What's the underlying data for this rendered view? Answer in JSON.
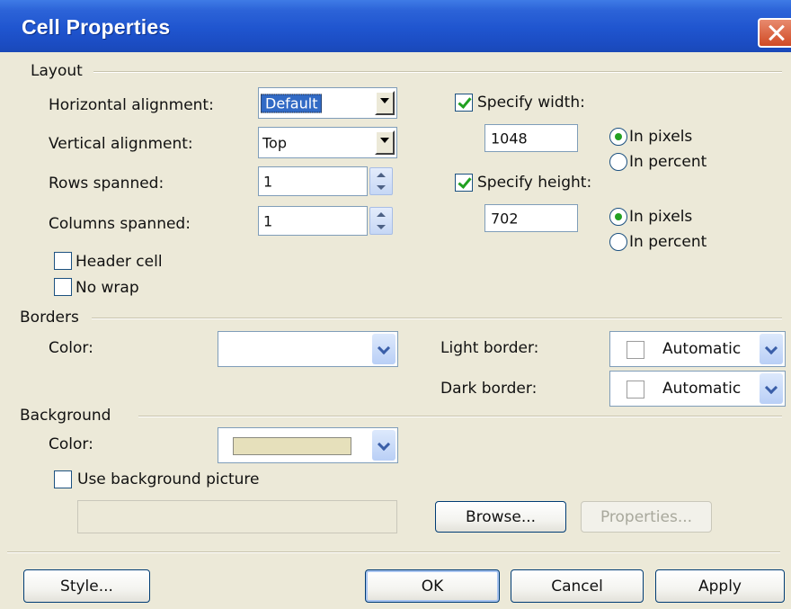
{
  "window": {
    "title": "Cell Properties"
  },
  "layout": {
    "section_label": "Layout",
    "horizontal_alignment_label": "Horizontal alignment:",
    "horizontal_alignment_value": "Default",
    "vertical_alignment_label": "Vertical alignment:",
    "vertical_alignment_value": "Top",
    "rows_spanned_label": "Rows spanned:",
    "rows_spanned_value": "1",
    "columns_spanned_label": "Columns spanned:",
    "columns_spanned_value": "1",
    "header_cell_label": "Header cell",
    "header_cell_checked": false,
    "no_wrap_label": "No wrap",
    "no_wrap_checked": false,
    "specify_width_label": "Specify width:",
    "specify_width_checked": true,
    "width_value": "1048",
    "width_unit_pixels_label": "In pixels",
    "width_unit_percent_label": "In percent",
    "width_unit_selected": "pixels",
    "specify_height_label": "Specify height:",
    "specify_height_checked": true,
    "height_value": "702",
    "height_unit_pixels_label": "In pixels",
    "height_unit_percent_label": "In percent",
    "height_unit_selected": "pixels"
  },
  "borders": {
    "section_label": "Borders",
    "color_label": "Color:",
    "color_value": "",
    "light_border_label": "Light border:",
    "light_border_value": "Automatic",
    "dark_border_label": "Dark border:",
    "dark_border_value": "Automatic"
  },
  "background": {
    "section_label": "Background",
    "color_label": "Color:",
    "color_swatch": "#e6e0bb",
    "use_picture_label": "Use background picture",
    "use_picture_checked": false,
    "picture_path": "",
    "browse_label": "Browse...",
    "properties_label": "Properties..."
  },
  "footer": {
    "style_label": "Style...",
    "ok_label": "OK",
    "cancel_label": "Cancel",
    "apply_label": "Apply"
  },
  "colors": {
    "titlebar": "#1f55cf",
    "dialog_bg": "#ece9d8",
    "close_button": "#d04a24",
    "selection": "#316ac5",
    "check_mark": "#21a121"
  }
}
